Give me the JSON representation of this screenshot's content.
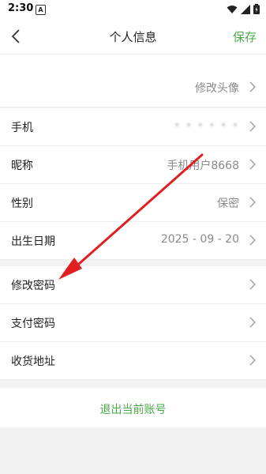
{
  "status_bar": {
    "time": "2:30",
    "notification_icon": "A",
    "wifi_icon": "wifi-icon",
    "signal_icon": "signal-icon",
    "battery_icon": "battery-icon"
  },
  "header": {
    "title": "个人信息",
    "save_label": "保存",
    "back_icon": "back-chevron-icon"
  },
  "rows": {
    "avatar": {
      "value": "修改头像"
    },
    "phone": {
      "label": "手机",
      "value": "• • • • • •"
    },
    "nickname": {
      "label": "昵称",
      "value": "手机用户8668"
    },
    "gender": {
      "label": "性别",
      "value": "保密"
    },
    "birthday": {
      "label": "出生日期",
      "value": "2025 - 09 - 20"
    },
    "change_password": {
      "label": "修改密码"
    },
    "payment_password": {
      "label": "支付密码"
    },
    "shipping_address": {
      "label": "收货地址"
    }
  },
  "logout_label": "退出当前账号",
  "colors": {
    "accent": "#4aaa4a",
    "annotation_arrow": "#e02020"
  }
}
